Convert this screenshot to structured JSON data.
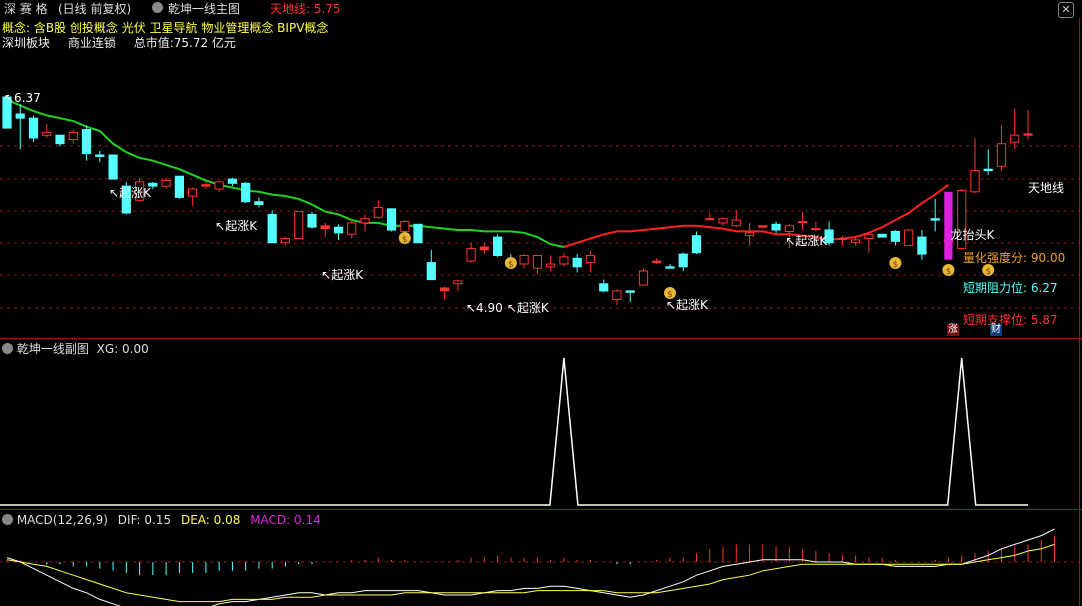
{
  "header": {
    "stock_name": "深 赛 格",
    "period": "(日线 前复权)",
    "indicator_main": "乾坤一线主图",
    "tiandi_label": "天地线: 5.75"
  },
  "info": {
    "concepts_label": "概念:",
    "concepts": "含B股 创投概念 光伏 卫星导航 物业管理概念 BIPV概念",
    "board": "深圳板块",
    "industry": "商业连锁",
    "market_cap": "总市值:75.72 亿元"
  },
  "main_chart": {
    "high_marker": "6.37",
    "low_marker": "4.90",
    "qizhang_label": "起涨K",
    "longtou_label": "龙抬头K",
    "tiandi_line_label": "天地线",
    "strength": "量化强度分: 90.00",
    "resistance": "短期阻力位: 6.27",
    "support": "短期支撑位: 5.87",
    "badge_zhang": "涨",
    "badge_cai": "财"
  },
  "sub_chart": {
    "title": "乾坤一线副图",
    "xg": "XG: 0.00"
  },
  "macd": {
    "title": "MACD(12,26,9)",
    "dif": "DIF: 0.15",
    "dea": "DEA: 0.08",
    "macd": "MACD: 0.14"
  },
  "colors": {
    "up": "#ff3232",
    "down": "#54ffff",
    "green_line": "#1fd31f",
    "red_line": "#ff2020",
    "magenta": "#e020e0",
    "yellow": "#ffff4d",
    "orange": "#f0a030",
    "grid": "#8b1a1a"
  },
  "chart_data": {
    "type": "candlestick",
    "title": "乾坤一线主图",
    "candles_ohlc": [
      [
        6.37,
        6.37,
        6.15,
        6.15
      ],
      [
        6.25,
        6.32,
        6.0,
        6.22
      ],
      [
        6.22,
        6.24,
        6.05,
        6.08
      ],
      [
        6.1,
        6.18,
        6.08,
        6.12
      ],
      [
        6.1,
        6.1,
        6.02,
        6.04
      ],
      [
        6.07,
        6.14,
        6.04,
        6.12
      ],
      [
        6.14,
        6.17,
        5.92,
        5.97
      ],
      [
        5.96,
        5.99,
        5.91,
        5.95
      ],
      [
        5.96,
        5.96,
        5.79,
        5.79
      ],
      [
        5.74,
        5.77,
        5.54,
        5.55
      ],
      [
        5.64,
        5.8,
        5.63,
        5.77
      ],
      [
        5.76,
        5.77,
        5.72,
        5.74
      ],
      [
        5.74,
        5.8,
        5.72,
        5.78
      ],
      [
        5.81,
        5.81,
        5.65,
        5.66
      ],
      [
        5.67,
        5.73,
        5.6,
        5.72
      ],
      [
        5.74,
        5.77,
        5.72,
        5.75
      ],
      [
        5.72,
        5.78,
        5.7,
        5.77
      ],
      [
        5.79,
        5.8,
        5.74,
        5.76
      ],
      [
        5.76,
        5.77,
        5.62,
        5.63
      ],
      [
        5.63,
        5.66,
        5.59,
        5.61
      ],
      [
        5.54,
        5.57,
        5.34,
        5.34
      ],
      [
        5.34,
        5.38,
        5.32,
        5.37
      ],
      [
        5.37,
        5.56,
        5.37,
        5.56
      ],
      [
        5.54,
        5.56,
        5.44,
        5.45
      ],
      [
        5.44,
        5.48,
        5.38,
        5.46
      ],
      [
        5.45,
        5.47,
        5.36,
        5.41
      ],
      [
        5.4,
        5.5,
        5.37,
        5.48
      ],
      [
        5.48,
        5.54,
        5.42,
        5.51
      ],
      [
        5.52,
        5.64,
        5.51,
        5.59
      ],
      [
        5.58,
        5.58,
        5.42,
        5.43
      ],
      [
        5.42,
        5.5,
        5.4,
        5.49
      ],
      [
        5.47,
        5.47,
        5.34,
        5.34
      ],
      [
        5.2,
        5.29,
        5.08,
        5.08
      ],
      [
        5.0,
        5.03,
        4.94,
        5.02
      ],
      [
        5.05,
        5.08,
        5.0,
        5.07
      ],
      [
        5.21,
        5.34,
        5.2,
        5.3
      ],
      [
        5.29,
        5.34,
        5.26,
        5.31
      ],
      [
        5.38,
        5.4,
        5.24,
        5.25
      ],
      [
        5.21,
        5.26,
        5.16,
        5.19
      ],
      [
        5.19,
        5.26,
        5.16,
        5.25
      ],
      [
        5.16,
        5.25,
        5.12,
        5.25
      ],
      [
        5.17,
        5.25,
        5.14,
        5.19
      ],
      [
        5.19,
        5.27,
        5.17,
        5.24
      ],
      [
        5.23,
        5.26,
        5.13,
        5.17
      ],
      [
        5.2,
        5.28,
        5.13,
        5.25
      ],
      [
        5.05,
        5.08,
        4.99,
        5.0
      ],
      [
        4.94,
        5.01,
        4.9,
        5.0
      ],
      [
        5.0,
        5.0,
        4.92,
        4.99
      ],
      [
        5.04,
        5.16,
        5.04,
        5.14
      ],
      [
        5.2,
        5.23,
        5.19,
        5.21
      ],
      [
        5.17,
        5.19,
        5.16,
        5.16
      ],
      [
        5.26,
        5.27,
        5.14,
        5.17
      ],
      [
        5.39,
        5.42,
        5.26,
        5.27
      ],
      [
        5.51,
        5.55,
        5.5,
        5.51
      ],
      [
        5.48,
        5.52,
        5.46,
        5.51
      ],
      [
        5.46,
        5.57,
        5.45,
        5.5
      ],
      [
        5.39,
        5.48,
        5.32,
        5.41
      ],
      [
        5.45,
        5.46,
        5.44,
        5.46
      ],
      [
        5.47,
        5.49,
        5.41,
        5.43
      ],
      [
        5.42,
        5.47,
        5.3,
        5.46
      ],
      [
        5.49,
        5.56,
        5.43,
        5.49
      ],
      [
        5.44,
        5.49,
        5.42,
        5.44
      ],
      [
        5.43,
        5.49,
        5.32,
        5.34
      ],
      [
        5.37,
        5.39,
        5.32,
        5.37
      ],
      [
        5.34,
        5.38,
        5.32,
        5.36
      ],
      [
        5.37,
        5.4,
        5.27,
        5.4
      ],
      [
        5.4,
        5.4,
        5.38,
        5.38
      ],
      [
        5.42,
        5.43,
        5.32,
        5.35
      ],
      [
        5.32,
        5.43,
        5.32,
        5.43
      ],
      [
        5.38,
        5.43,
        5.22,
        5.26
      ],
      [
        5.51,
        5.65,
        5.42,
        5.5
      ],
      [
        5.35,
        5.41,
        5.29,
        5.36
      ],
      [
        5.3,
        5.72,
        5.29,
        5.71
      ],
      [
        5.7,
        6.08,
        5.69,
        5.85
      ],
      [
        5.86,
        6.0,
        5.82,
        5.85
      ],
      [
        5.88,
        6.17,
        5.85,
        6.04
      ],
      [
        6.05,
        6.29,
        6.0,
        6.1
      ],
      [
        6.1,
        6.28,
        6.07,
        6.11
      ]
    ],
    "tiandi_line_green": [
      6.35,
      6.31,
      6.27,
      6.24,
      6.22,
      6.2,
      6.16,
      6.13,
      6.04,
      5.98,
      5.94,
      5.92,
      5.89,
      5.86,
      5.82,
      5.78,
      5.75,
      5.73,
      5.71,
      5.7,
      5.68,
      5.67,
      5.65,
      5.61,
      5.56,
      5.54,
      5.5,
      5.48,
      5.48,
      5.46,
      5.46,
      5.46,
      5.45,
      5.44,
      5.43,
      5.43,
      5.42,
      5.42,
      5.42,
      5.41,
      5.38,
      5.33,
      5.31
    ],
    "tiandi_line_red": [
      5.31,
      5.34,
      5.37,
      5.4,
      5.42,
      5.42,
      5.43,
      5.44,
      5.45,
      5.46,
      5.46,
      5.45,
      5.44,
      5.42,
      5.42,
      5.42,
      5.4,
      5.4,
      5.39,
      5.38,
      5.36,
      5.37,
      5.38,
      5.41,
      5.45,
      5.5,
      5.55,
      5.62,
      5.68,
      5.75
    ],
    "xg_peaks": [
      {
        "index": 42,
        "value": 1
      },
      {
        "index": 72,
        "value": 1
      }
    ],
    "macd_hist": [
      0.01,
      0.01,
      0.0,
      -0.01,
      -0.01,
      -0.02,
      -0.02,
      -0.03,
      -0.04,
      -0.05,
      -0.06,
      -0.06,
      -0.06,
      -0.05,
      -0.05,
      -0.05,
      -0.04,
      -0.04,
      -0.04,
      -0.03,
      -0.03,
      -0.02,
      -0.01,
      -0.01,
      0.0,
      0.0,
      0.01,
      0.01,
      0.02,
      0.01,
      0.01,
      0.0,
      0.0,
      0.0,
      0.01,
      0.02,
      0.02,
      0.03,
      0.02,
      0.02,
      0.02,
      0.01,
      0.02,
      0.01,
      0.01,
      0.0,
      -0.01,
      -0.01,
      0.0,
      0.01,
      0.02,
      0.02,
      0.04,
      0.06,
      0.07,
      0.08,
      0.08,
      0.08,
      0.07,
      0.07,
      0.06,
      0.05,
      0.04,
      0.03,
      0.03,
      0.02,
      0.02,
      0.01,
      0.0,
      0.0,
      0.01,
      0.02,
      0.03,
      0.04,
      0.05,
      0.06,
      0.07,
      0.08,
      0.1,
      0.12
    ],
    "dif": [
      0.02,
      0.0,
      -0.03,
      -0.06,
      -0.09,
      -0.12,
      -0.14,
      -0.17,
      -0.19,
      -0.21,
      -0.22,
      -0.22,
      -0.22,
      -0.22,
      -0.21,
      -0.21,
      -0.19,
      -0.18,
      -0.18,
      -0.17,
      -0.16,
      -0.15,
      -0.14,
      -0.14,
      -0.15,
      -0.14,
      -0.14,
      -0.13,
      -0.13,
      -0.13,
      -0.13,
      -0.13,
      -0.14,
      -0.15,
      -0.15,
      -0.15,
      -0.14,
      -0.13,
      -0.13,
      -0.12,
      -0.12,
      -0.11,
      -0.11,
      -0.12,
      -0.13,
      -0.14,
      -0.15,
      -0.16,
      -0.15,
      -0.13,
      -0.11,
      -0.09,
      -0.06,
      -0.04,
      -0.02,
      -0.01,
      0.0,
      0.01,
      0.01,
      0.01,
      0.01,
      0.0,
      0.0,
      0.0,
      -0.01,
      -0.01,
      -0.01,
      -0.02,
      -0.02,
      -0.02,
      -0.02,
      -0.01,
      -0.01,
      0.01,
      0.03,
      0.06,
      0.08,
      0.1,
      0.12,
      0.15
    ],
    "dea": [
      0.01,
      0.0,
      -0.01,
      -0.02,
      -0.04,
      -0.06,
      -0.08,
      -0.1,
      -0.12,
      -0.14,
      -0.15,
      -0.16,
      -0.17,
      -0.18,
      -0.18,
      -0.18,
      -0.18,
      -0.17,
      -0.17,
      -0.17,
      -0.17,
      -0.16,
      -0.16,
      -0.16,
      -0.15,
      -0.15,
      -0.15,
      -0.15,
      -0.15,
      -0.15,
      -0.14,
      -0.14,
      -0.14,
      -0.14,
      -0.14,
      -0.14,
      -0.14,
      -0.14,
      -0.14,
      -0.14,
      -0.13,
      -0.13,
      -0.13,
      -0.13,
      -0.13,
      -0.13,
      -0.14,
      -0.14,
      -0.14,
      -0.14,
      -0.13,
      -0.12,
      -0.11,
      -0.1,
      -0.08,
      -0.07,
      -0.06,
      -0.04,
      -0.03,
      -0.02,
      -0.01,
      -0.01,
      -0.01,
      -0.01,
      -0.01,
      -0.01,
      -0.01,
      -0.01,
      -0.01,
      -0.01,
      -0.01,
      -0.01,
      -0.01,
      0.0,
      0.01,
      0.02,
      0.03,
      0.05,
      0.06,
      0.08
    ]
  }
}
